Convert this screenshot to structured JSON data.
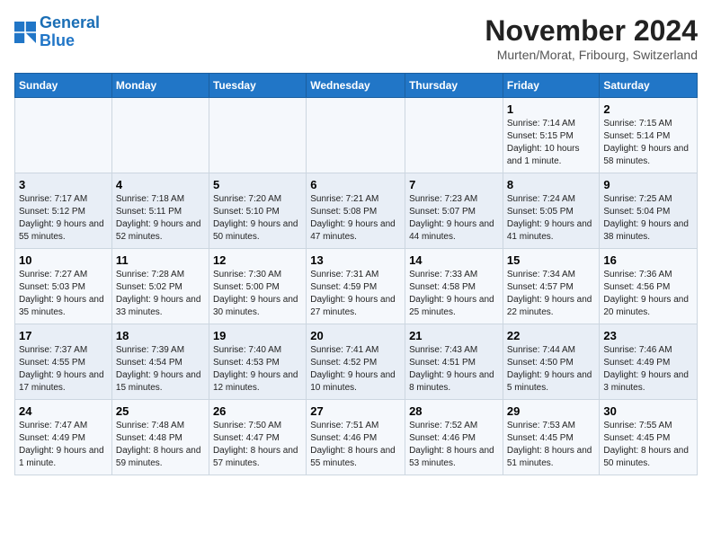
{
  "logo": {
    "line1": "General",
    "line2": "Blue"
  },
  "title": "November 2024",
  "location": "Murten/Morat, Fribourg, Switzerland",
  "weekdays": [
    "Sunday",
    "Monday",
    "Tuesday",
    "Wednesday",
    "Thursday",
    "Friday",
    "Saturday"
  ],
  "weeks": [
    [
      {
        "day": "",
        "info": ""
      },
      {
        "day": "",
        "info": ""
      },
      {
        "day": "",
        "info": ""
      },
      {
        "day": "",
        "info": ""
      },
      {
        "day": "",
        "info": ""
      },
      {
        "day": "1",
        "info": "Sunrise: 7:14 AM\nSunset: 5:15 PM\nDaylight: 10 hours and 1 minute."
      },
      {
        "day": "2",
        "info": "Sunrise: 7:15 AM\nSunset: 5:14 PM\nDaylight: 9 hours and 58 minutes."
      }
    ],
    [
      {
        "day": "3",
        "info": "Sunrise: 7:17 AM\nSunset: 5:12 PM\nDaylight: 9 hours and 55 minutes."
      },
      {
        "day": "4",
        "info": "Sunrise: 7:18 AM\nSunset: 5:11 PM\nDaylight: 9 hours and 52 minutes."
      },
      {
        "day": "5",
        "info": "Sunrise: 7:20 AM\nSunset: 5:10 PM\nDaylight: 9 hours and 50 minutes."
      },
      {
        "day": "6",
        "info": "Sunrise: 7:21 AM\nSunset: 5:08 PM\nDaylight: 9 hours and 47 minutes."
      },
      {
        "day": "7",
        "info": "Sunrise: 7:23 AM\nSunset: 5:07 PM\nDaylight: 9 hours and 44 minutes."
      },
      {
        "day": "8",
        "info": "Sunrise: 7:24 AM\nSunset: 5:05 PM\nDaylight: 9 hours and 41 minutes."
      },
      {
        "day": "9",
        "info": "Sunrise: 7:25 AM\nSunset: 5:04 PM\nDaylight: 9 hours and 38 minutes."
      }
    ],
    [
      {
        "day": "10",
        "info": "Sunrise: 7:27 AM\nSunset: 5:03 PM\nDaylight: 9 hours and 35 minutes."
      },
      {
        "day": "11",
        "info": "Sunrise: 7:28 AM\nSunset: 5:02 PM\nDaylight: 9 hours and 33 minutes."
      },
      {
        "day": "12",
        "info": "Sunrise: 7:30 AM\nSunset: 5:00 PM\nDaylight: 9 hours and 30 minutes."
      },
      {
        "day": "13",
        "info": "Sunrise: 7:31 AM\nSunset: 4:59 PM\nDaylight: 9 hours and 27 minutes."
      },
      {
        "day": "14",
        "info": "Sunrise: 7:33 AM\nSunset: 4:58 PM\nDaylight: 9 hours and 25 minutes."
      },
      {
        "day": "15",
        "info": "Sunrise: 7:34 AM\nSunset: 4:57 PM\nDaylight: 9 hours and 22 minutes."
      },
      {
        "day": "16",
        "info": "Sunrise: 7:36 AM\nSunset: 4:56 PM\nDaylight: 9 hours and 20 minutes."
      }
    ],
    [
      {
        "day": "17",
        "info": "Sunrise: 7:37 AM\nSunset: 4:55 PM\nDaylight: 9 hours and 17 minutes."
      },
      {
        "day": "18",
        "info": "Sunrise: 7:39 AM\nSunset: 4:54 PM\nDaylight: 9 hours and 15 minutes."
      },
      {
        "day": "19",
        "info": "Sunrise: 7:40 AM\nSunset: 4:53 PM\nDaylight: 9 hours and 12 minutes."
      },
      {
        "day": "20",
        "info": "Sunrise: 7:41 AM\nSunset: 4:52 PM\nDaylight: 9 hours and 10 minutes."
      },
      {
        "day": "21",
        "info": "Sunrise: 7:43 AM\nSunset: 4:51 PM\nDaylight: 9 hours and 8 minutes."
      },
      {
        "day": "22",
        "info": "Sunrise: 7:44 AM\nSunset: 4:50 PM\nDaylight: 9 hours and 5 minutes."
      },
      {
        "day": "23",
        "info": "Sunrise: 7:46 AM\nSunset: 4:49 PM\nDaylight: 9 hours and 3 minutes."
      }
    ],
    [
      {
        "day": "24",
        "info": "Sunrise: 7:47 AM\nSunset: 4:49 PM\nDaylight: 9 hours and 1 minute."
      },
      {
        "day": "25",
        "info": "Sunrise: 7:48 AM\nSunset: 4:48 PM\nDaylight: 8 hours and 59 minutes."
      },
      {
        "day": "26",
        "info": "Sunrise: 7:50 AM\nSunset: 4:47 PM\nDaylight: 8 hours and 57 minutes."
      },
      {
        "day": "27",
        "info": "Sunrise: 7:51 AM\nSunset: 4:46 PM\nDaylight: 8 hours and 55 minutes."
      },
      {
        "day": "28",
        "info": "Sunrise: 7:52 AM\nSunset: 4:46 PM\nDaylight: 8 hours and 53 minutes."
      },
      {
        "day": "29",
        "info": "Sunrise: 7:53 AM\nSunset: 4:45 PM\nDaylight: 8 hours and 51 minutes."
      },
      {
        "day": "30",
        "info": "Sunrise: 7:55 AM\nSunset: 4:45 PM\nDaylight: 8 hours and 50 minutes."
      }
    ]
  ]
}
